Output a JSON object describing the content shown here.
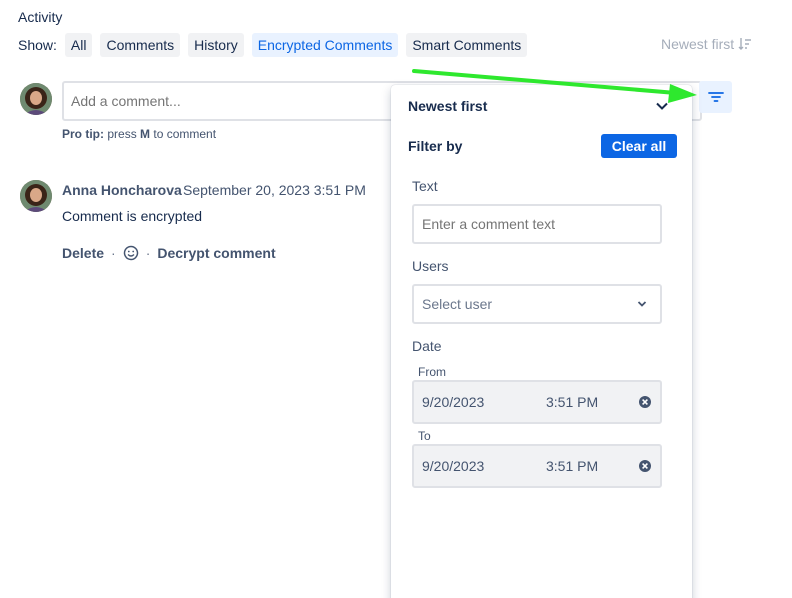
{
  "activity": {
    "title": "Activity",
    "show_label": "Show:",
    "filters": [
      "All",
      "Comments",
      "History",
      "Encrypted Comments",
      "Smart Comments"
    ],
    "active_filter": "Encrypted Comments",
    "sort_label": "Newest first"
  },
  "composer": {
    "placeholder": "Add a comment...",
    "protip_prefix": "Pro tip:",
    "protip_press": "press",
    "protip_key": "M",
    "protip_suffix": "to comment"
  },
  "comment": {
    "author": "Anna Honcharova",
    "date": "September 20, 2023 3:51 PM",
    "body": "Comment is encrypted",
    "actions": {
      "delete": "Delete",
      "decrypt": "Decrypt comment",
      "separator": "·"
    }
  },
  "filter_panel": {
    "sort": "Newest first",
    "filter_by": "Filter by",
    "clear_all": "Clear all",
    "text_label": "Text",
    "text_placeholder": "Enter a comment text",
    "users_label": "Users",
    "users_placeholder": "Select user",
    "date_label": "Date",
    "from_label": "From",
    "from_date": "9/20/2023",
    "from_time": "3:51 PM",
    "to_label": "To",
    "to_date": "9/20/2023",
    "to_time": "3:51 PM"
  },
  "colors": {
    "accent": "#0c66e4",
    "annotation_arrow": "#2ee82e"
  },
  "icons": {
    "filter": "filter-icon",
    "sort": "sort-descending-icon",
    "chevron": "chevron-down-icon",
    "clear": "clear-circle-icon",
    "emoji": "smiley-icon"
  }
}
